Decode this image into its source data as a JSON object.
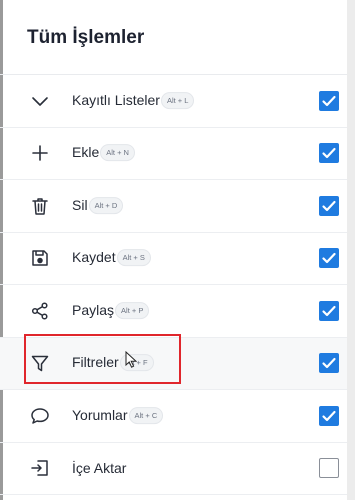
{
  "panel": {
    "title": "Tüm İşlemler"
  },
  "items": [
    {
      "label": "Kayıtlı Listeler",
      "shortcut": "Alt + L",
      "icon": "chevron-down-icon",
      "checked": true
    },
    {
      "label": "Ekle",
      "shortcut": "Alt + N",
      "icon": "plus-icon",
      "checked": true
    },
    {
      "label": "Sil",
      "shortcut": "Alt + D",
      "icon": "trash-icon",
      "checked": true
    },
    {
      "label": "Kaydet",
      "shortcut": "Alt + S",
      "icon": "save-icon",
      "checked": true
    },
    {
      "label": "Paylaş",
      "shortcut": "Alt + P",
      "icon": "share-icon",
      "checked": true
    },
    {
      "label": "Filtreler",
      "shortcut": "Alt + F",
      "icon": "filter-icon",
      "checked": true
    },
    {
      "label": "Yorumlar",
      "shortcut": "Alt + C",
      "icon": "comment-icon",
      "checked": true
    },
    {
      "label": "İçe Aktar",
      "shortcut": "",
      "icon": "import-icon",
      "checked": false
    }
  ],
  "colors": {
    "checkbox_accent": "#1f7be0",
    "highlight": "#e0262c"
  }
}
